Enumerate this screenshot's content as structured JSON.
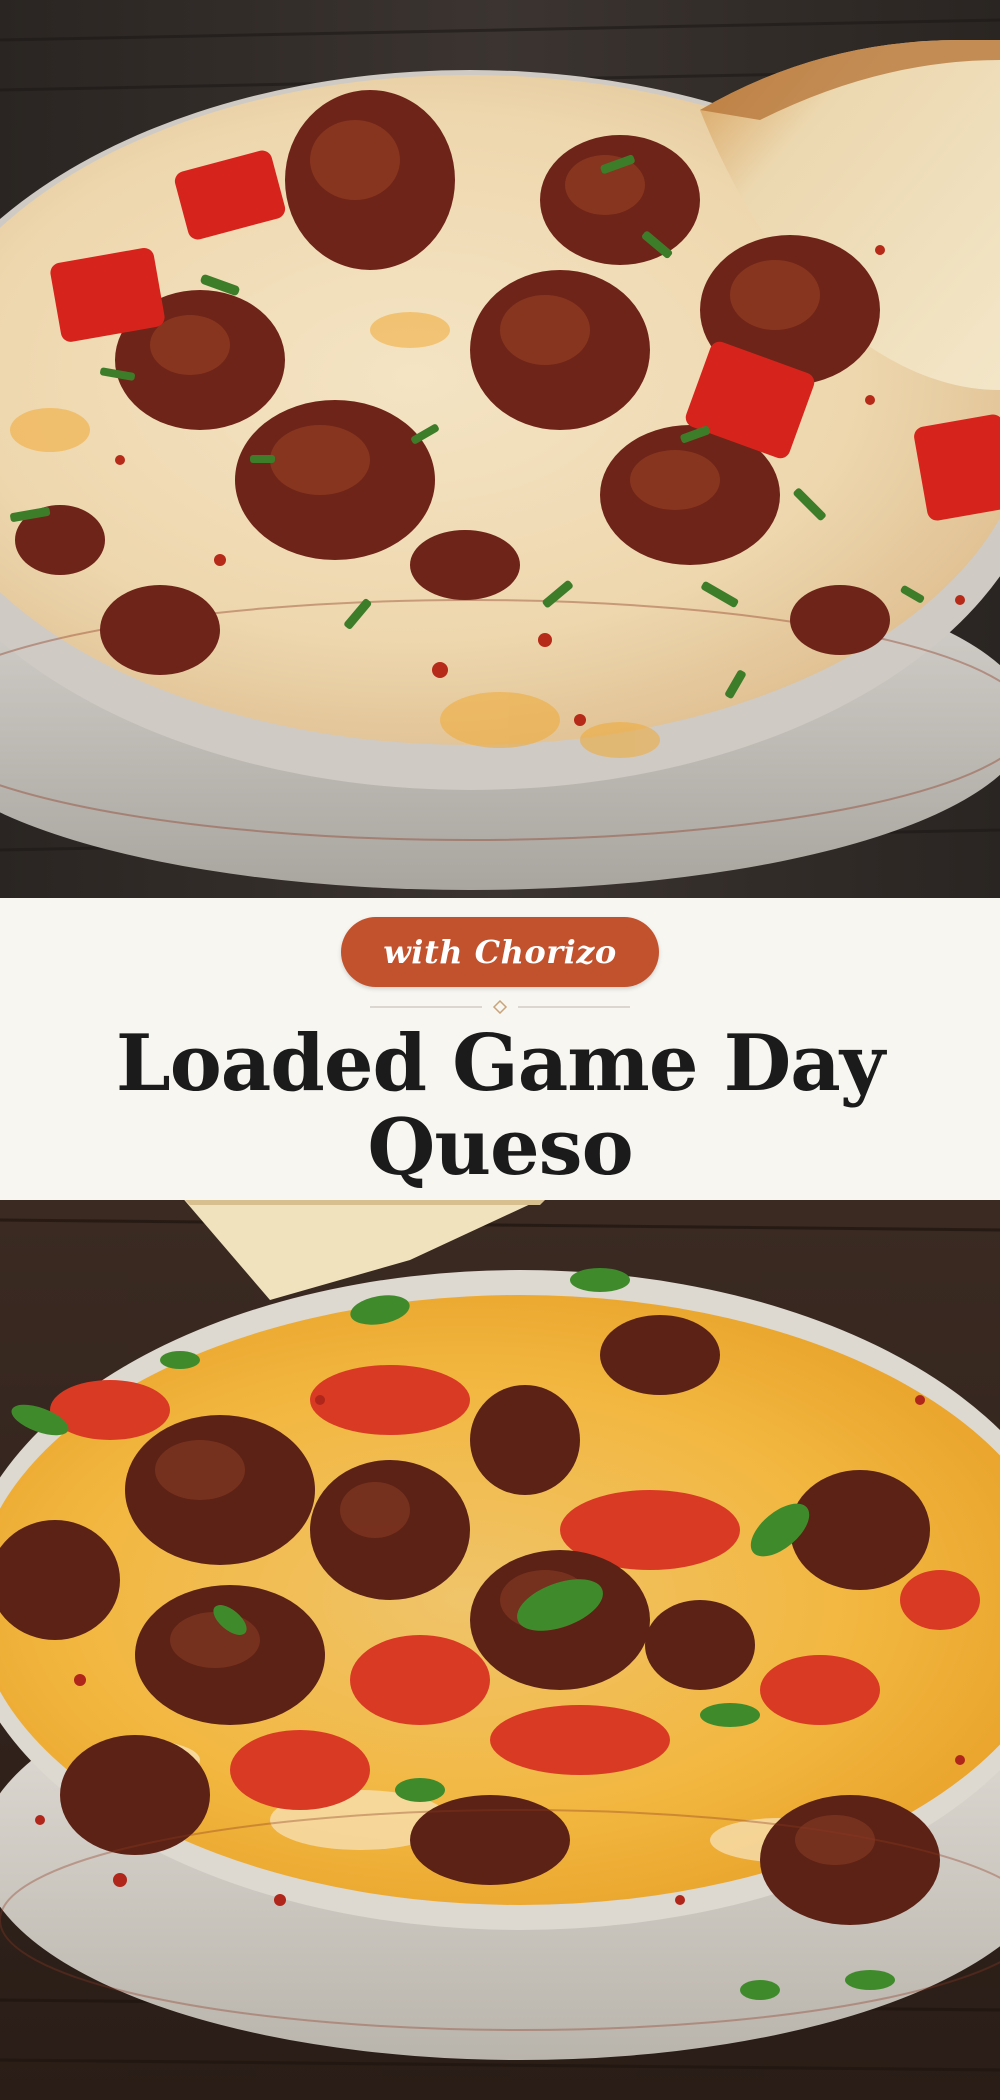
{
  "badge": {
    "label": "with Chorizo"
  },
  "title": {
    "line1": "Loaded Game Day",
    "line2": "Queso"
  },
  "photos": {
    "top": {
      "subject": "white queso with chorizo, red peppers, herbs and bread"
    },
    "bottom": {
      "subject": "orange queso with chorizo, tomatoes, cilantro and chip"
    }
  },
  "colors": {
    "badge": "#c2512d",
    "banner": "#f8f6f1",
    "title": "#1b1b1b",
    "divider_accent": "#c9a37a"
  }
}
